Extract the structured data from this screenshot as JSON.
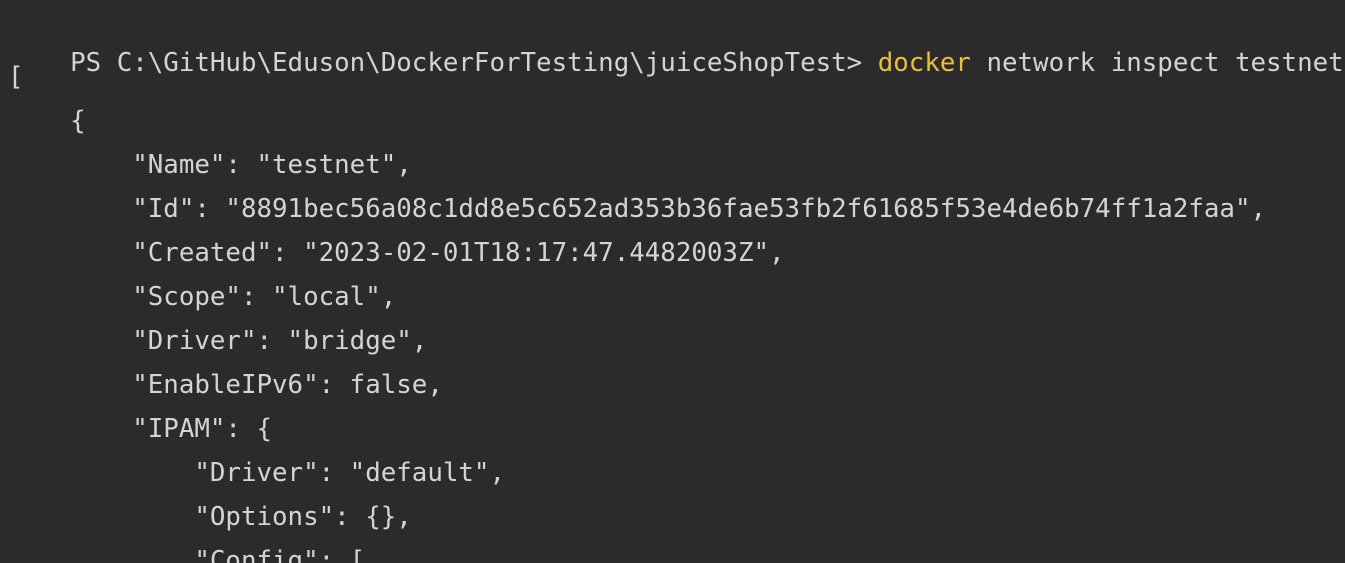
{
  "terminal": {
    "background": "#2b2b2b",
    "text_color": "#d4d4d4",
    "keyword_color": "#e8bf3a",
    "prompt": "PS C:\\GitHub\\Eduson\\DockerForTesting\\juiceShopTest> ",
    "command_keyword": "docker",
    "command_rest": " network inspect testnet",
    "output_lines": [
      "[",
      "    {",
      "        \"Name\": \"testnet\",",
      "        \"Id\": \"8891bec56a08c1dd8e5c652ad353b36fae53fb2f61685f53e4de6b74ff1a2faa\",",
      "        \"Created\": \"2023-02-01T18:17:47.4482003Z\",",
      "        \"Scope\": \"local\",",
      "        \"Driver\": \"bridge\",",
      "        \"EnableIPv6\": false,",
      "        \"IPAM\": {",
      "            \"Driver\": \"default\",",
      "            \"Options\": {},",
      "            \"Config\": ["
    ]
  }
}
